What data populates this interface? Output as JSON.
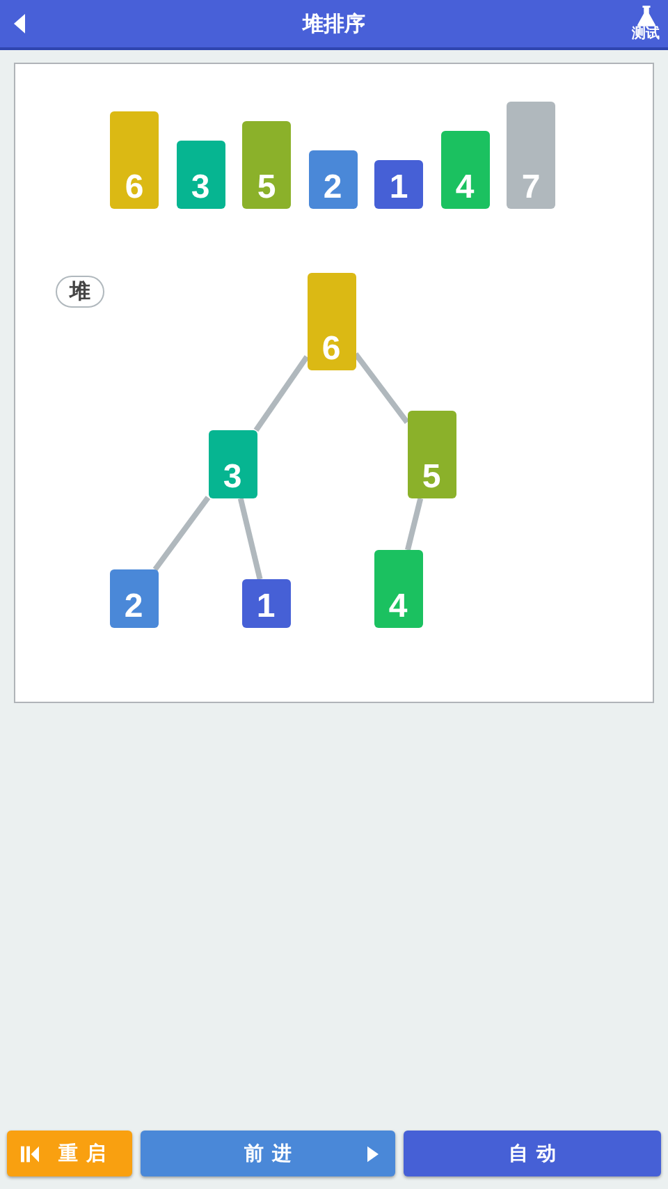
{
  "header": {
    "title": "堆排序",
    "test_button": "测试"
  },
  "bars": [
    {
      "value": "6",
      "color": "#dbb914"
    },
    {
      "value": "3",
      "color": "#06b591"
    },
    {
      "value": "5",
      "color": "#8bb12a"
    },
    {
      "value": "2",
      "color": "#4a88d8"
    },
    {
      "value": "1",
      "color": "#4660d6"
    },
    {
      "value": "4",
      "color": "#1bc160"
    },
    {
      "value": "7",
      "color": "#b0b8bd"
    }
  ],
  "heap": {
    "label": "堆",
    "tree": {
      "value": "6",
      "color": "#dbb914",
      "children": [
        {
          "value": "3",
          "color": "#06b591",
          "children": [
            {
              "value": "2",
              "color": "#4a88d8"
            },
            {
              "value": "1",
              "color": "#4660d6"
            }
          ]
        },
        {
          "value": "5",
          "color": "#8bb12a",
          "children": [
            {
              "value": "4",
              "color": "#1bc160"
            }
          ]
        }
      ]
    }
  },
  "buttons": [
    {
      "label": "重启",
      "kind": "restart"
    },
    {
      "label": "前进",
      "kind": "step"
    },
    {
      "label": "自动",
      "kind": "auto"
    }
  ]
}
